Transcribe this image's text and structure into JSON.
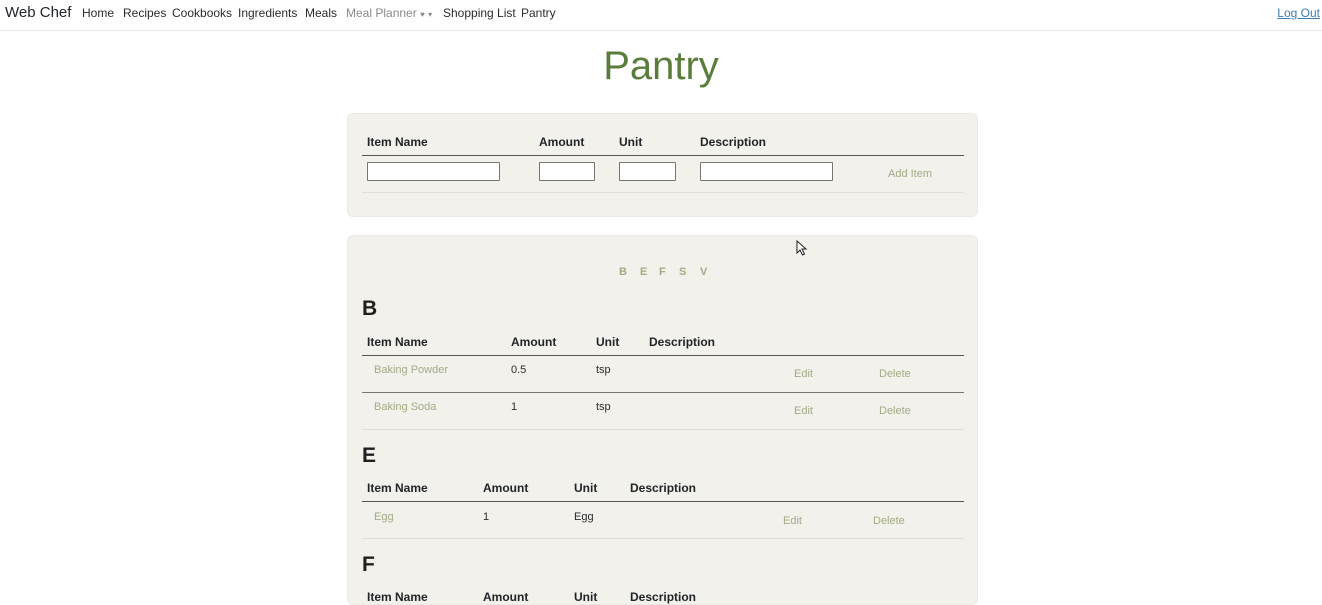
{
  "nav": {
    "brand": "Web Chef",
    "items": [
      "Home",
      "Recipes",
      "Cookbooks",
      "Ingredients",
      "Meals",
      "Meal Planner",
      "Shopping List",
      "Pantry"
    ],
    "logout": "Log Out"
  },
  "page": {
    "title": "Pantry"
  },
  "add_form": {
    "headers": [
      "Item Name",
      "Amount",
      "Unit",
      "Description"
    ],
    "values": {
      "name": "",
      "amount": "",
      "unit": "",
      "description": ""
    },
    "add_label": "Add Item"
  },
  "alphabet": [
    "B",
    "E",
    "F",
    "S",
    "V"
  ],
  "actions": {
    "edit": "Edit",
    "delete": "Delete"
  },
  "groups": [
    {
      "letter": "B",
      "headers": [
        "Item Name",
        "Amount",
        "Unit",
        "Description"
      ],
      "rows": [
        {
          "name": "Baking Powder",
          "amount": "0.5",
          "unit": "tsp",
          "description": ""
        },
        {
          "name": "Baking Soda",
          "amount": "1",
          "unit": "tsp",
          "description": ""
        }
      ]
    },
    {
      "letter": "E",
      "headers": [
        "Item Name",
        "Amount",
        "Unit",
        "Description"
      ],
      "rows": [
        {
          "name": "Egg",
          "amount": "1",
          "unit": "Egg",
          "description": ""
        }
      ]
    },
    {
      "letter": "F",
      "headers": [
        "Item Name",
        "Amount",
        "Unit",
        "Description"
      ],
      "rows": []
    }
  ]
}
